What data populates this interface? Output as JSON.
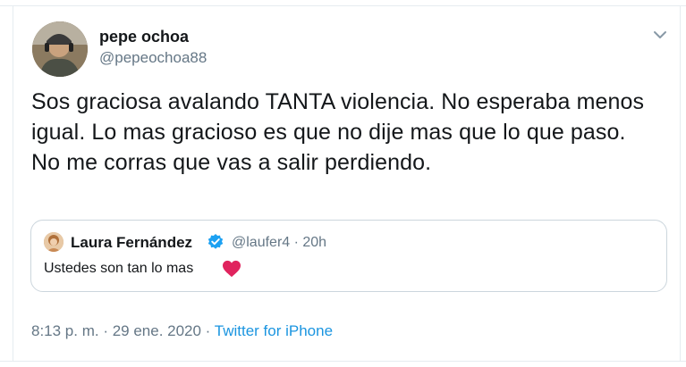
{
  "tweet": {
    "author": {
      "name": "pepe ochoa",
      "handle": "@pepeochoa88"
    },
    "text": "Sos graciosa avalando TANTA violencia. No esperaba menos igual. Lo mas gracioso es que no dije mas que lo que paso. No me corras que vas a salir perdiendo.",
    "quoted": {
      "name": "Laura Fernández",
      "handle": "@laufer4 · 20h",
      "text": "Ustedes son tan lo mas",
      "verified": true
    },
    "timestamp": "8:13 p. m. · 29 ene. 2020 · ",
    "source": "Twitter for iPhone"
  },
  "colors": {
    "accent": "#1b95e0",
    "secondary_text": "#657786",
    "heart": "#e0245e",
    "border": "#ccd6dd"
  },
  "icons": {
    "menu": "chevron-down-icon",
    "verified": "verified-badge-icon",
    "heart": "heart-icon"
  }
}
